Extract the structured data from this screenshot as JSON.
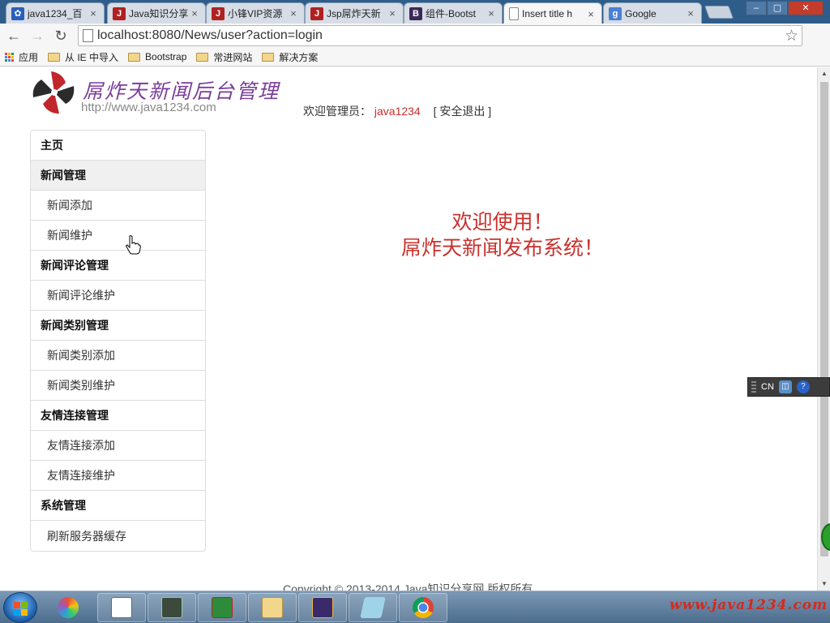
{
  "browser": {
    "tabs": [
      {
        "label": "java1234_百",
        "icon": "paw-icon",
        "color": "#2b5fbf"
      },
      {
        "label": "Java知识分享",
        "icon": "java-j-icon",
        "color": "#b02020"
      },
      {
        "label": "小锋VIP资源",
        "icon": "java-j-icon",
        "color": "#b02020"
      },
      {
        "label": "Jsp屌炸天新",
        "icon": "java-j-icon",
        "color": "#b02020"
      },
      {
        "label": "组件-Bootst",
        "icon": "bootstrap-b-icon",
        "color": "#3a2a57"
      },
      {
        "label": "Insert title h",
        "icon": "page-icon",
        "color": "#ffffff"
      },
      {
        "label": "Google",
        "icon": "google-g-icon",
        "color": "#4a7fd6"
      }
    ],
    "url": "localhost:8080/News/user?action=login",
    "bookmarks": [
      "应用",
      "从 IE 中导入",
      "Bootstrap",
      "常进网站",
      "解决方案"
    ]
  },
  "header": {
    "logo_title": "屌炸天新闻后台管理",
    "logo_url": "http://www.java1234.com",
    "welcome_prefix": "欢迎管理员：",
    "username": "java1234",
    "logout": "[ 安全退出 ]"
  },
  "nav": [
    {
      "label": "主页",
      "type": "head"
    },
    {
      "label": "新闻管理",
      "type": "head"
    },
    {
      "label": "新闻添加",
      "type": "sub"
    },
    {
      "label": "新闻维护",
      "type": "sub"
    },
    {
      "label": "新闻评论管理",
      "type": "head"
    },
    {
      "label": "新闻评论维护",
      "type": "sub"
    },
    {
      "label": "新闻类别管理",
      "type": "head"
    },
    {
      "label": "新闻类别添加",
      "type": "sub"
    },
    {
      "label": "新闻类别维护",
      "type": "sub"
    },
    {
      "label": "友情连接管理",
      "type": "head"
    },
    {
      "label": "友情连接添加",
      "type": "sub"
    },
    {
      "label": "友情连接维护",
      "type": "sub"
    },
    {
      "label": "系统管理",
      "type": "head"
    },
    {
      "label": "刷新服务器缓存",
      "type": "sub"
    }
  ],
  "main": {
    "greeting_line1": "欢迎使用！",
    "greeting_line2": "屌炸天新闻发布系统！",
    "footer": "Copyright © 2013-2014 Java知识分享网 版权所有"
  },
  "ime": {
    "label": "CN"
  },
  "taskbar": {
    "watermark": "www.java1234.com"
  }
}
